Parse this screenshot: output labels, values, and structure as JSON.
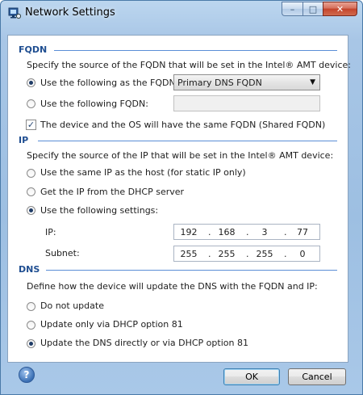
{
  "window": {
    "title": "Network Settings",
    "close_glyph": "✕",
    "max_glyph": "□",
    "min_glyph": "–"
  },
  "fqdn": {
    "heading": "FQDN",
    "description": "Specify the source of the FQDN that will be set in the Intel® AMT device:",
    "option_source_label": "Use the following as the FQDN:",
    "source_selected": "Primary DNS FQDN",
    "option_custom_label": "Use the following FQDN:",
    "custom_value": "",
    "shared_label": "The device and the OS will have the same FQDN (Shared FQDN)",
    "shared_checked": true
  },
  "ip": {
    "heading": "IP",
    "description": "Specify the source of the IP that will be set in the Intel® AMT device:",
    "option_same_label": "Use the same IP as the host (for static IP only)",
    "option_dhcp_label": "Get the IP from the DHCP server",
    "option_settings_label": "Use the following settings:",
    "ip_label": "IP:",
    "ip_octets": [
      "192",
      "168",
      "3",
      "77"
    ],
    "subnet_label": "Subnet:",
    "subnet_octets": [
      "255",
      "255",
      "255",
      "0"
    ]
  },
  "dns": {
    "heading": "DNS",
    "description": "Define how the device will update the DNS with the FQDN and IP:",
    "option_none_label": "Do not update",
    "option_dhcp81_label": "Update only via DHCP option 81",
    "option_direct_label": "Update the DNS directly or via DHCP option 81"
  },
  "footer": {
    "help_glyph": "?",
    "ok_label": "OK",
    "cancel_label": "Cancel"
  },
  "colors": {
    "accent": "#1f4e91",
    "frame": "#9dbfe2"
  },
  "icons": {
    "app": "network-settings-icon",
    "help": "help-icon"
  }
}
